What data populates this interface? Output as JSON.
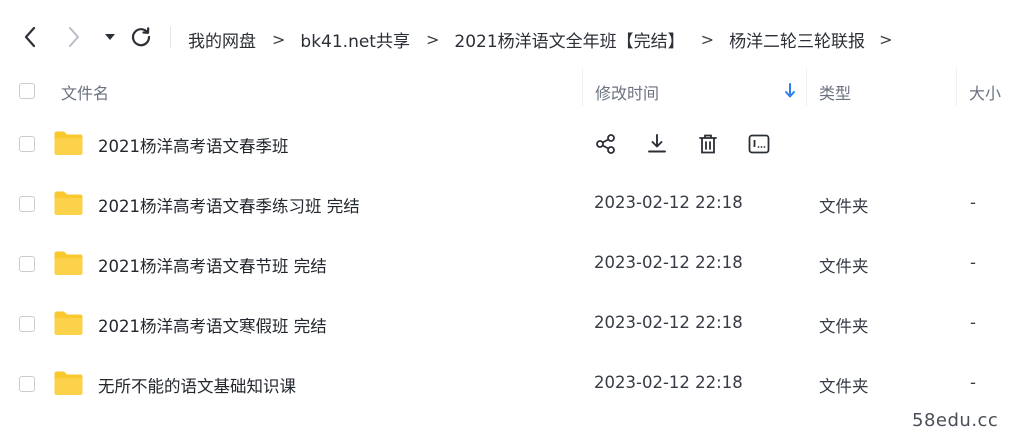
{
  "breadcrumb": {
    "items": [
      "我的网盘",
      "bk41.net共享",
      "2021杨洋语文全年班【完结】",
      "杨洋二轮三轮联报"
    ],
    "separator": ">"
  },
  "columns": {
    "name": "文件名",
    "modified": "修改时间",
    "type": "类型",
    "size": "大小"
  },
  "rows": [
    {
      "name": "2021杨洋高考语文春季班",
      "date": "",
      "type": "",
      "size": ""
    },
    {
      "name": "2021杨洋高考语文春季练习班 完结",
      "date": "2023-02-12 22:18",
      "type": "文件夹",
      "size": "-"
    },
    {
      "name": "2021杨洋高考语文春节班 完结",
      "date": "2023-02-12 22:18",
      "type": "文件夹",
      "size": "-"
    },
    {
      "name": "2021杨洋高考语文寒假班 完结",
      "date": "2023-02-12 22:18",
      "type": "文件夹",
      "size": "-"
    },
    {
      "name": "无所不能的语文基础知识课",
      "date": "2023-02-12 22:18",
      "type": "文件夹",
      "size": "-"
    }
  ],
  "watermark": "58edu.cc",
  "colors": {
    "folder": "#f9c82d",
    "sort_arrow": "#2f80ed"
  },
  "icons": [
    "back-icon",
    "forward-icon",
    "dropdown-icon",
    "refresh-icon",
    "share-icon",
    "download-icon",
    "delete-icon",
    "more-icon"
  ]
}
